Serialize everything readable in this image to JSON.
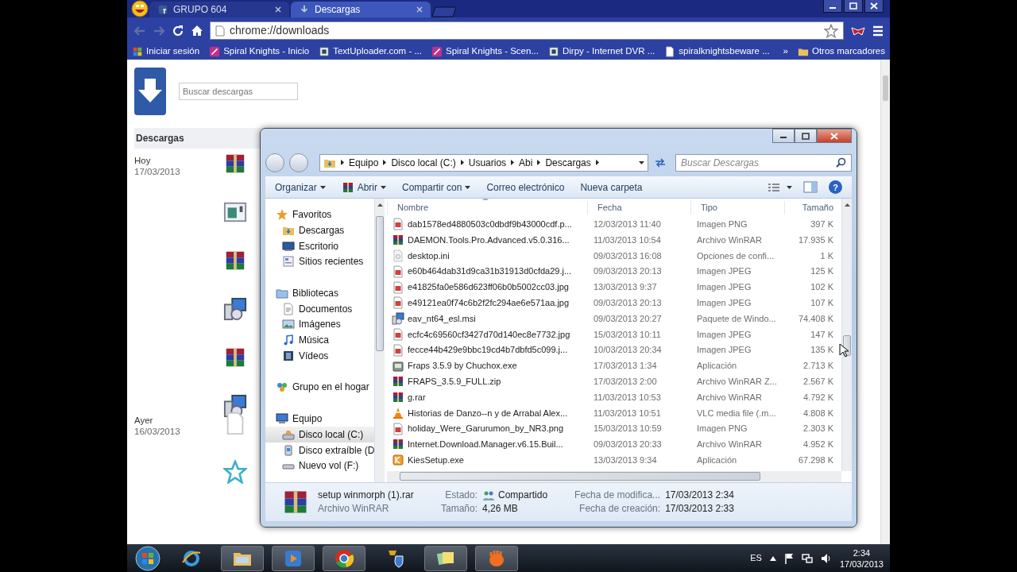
{
  "browser": {
    "tabs": [
      {
        "label": "GRUPO 604",
        "kind": "facebook",
        "selected": false
      },
      {
        "label": "Descargas",
        "kind": "download",
        "selected": true
      }
    ],
    "url": "chrome://downloads",
    "bookmarks": [
      {
        "label": "Iniciar sesión",
        "kind": "windows"
      },
      {
        "label": "Spiral Knights - Inicio",
        "kind": "sword"
      },
      {
        "label": "TextUploader.com - ...",
        "kind": "square"
      },
      {
        "label": "Spiral Knights - Scen...",
        "kind": "sword"
      },
      {
        "label": "Dirpy - Internet DVR ...",
        "kind": "square"
      },
      {
        "label": "spiralknightsbeware ...",
        "kind": "page"
      }
    ],
    "overflow": "»",
    "other_bookmarks": "Otros marcadores"
  },
  "downloads_page": {
    "search_placeholder": "Buscar descargas",
    "heading": "Descargas",
    "groups": [
      {
        "day": "Hoy",
        "date": "17/03/2013",
        "items": [
          {
            "kind": "rar"
          },
          {
            "kind": "window"
          },
          {
            "kind": "rar"
          },
          {
            "kind": "msi"
          },
          {
            "kind": "rar"
          },
          {
            "kind": "msi"
          }
        ]
      },
      {
        "day": "Ayer",
        "date": "16/03/2013",
        "items": [
          {
            "kind": "blank"
          },
          {
            "kind": "star"
          }
        ]
      }
    ]
  },
  "explorer": {
    "breadcrumb": [
      "Equipo",
      "Disco local (C:)",
      "Usuarios",
      "Abi",
      "Descargas"
    ],
    "search_placeholder": "Buscar Descargas",
    "commands": [
      {
        "label": "Organizar",
        "kind": "text",
        "dropdown": true
      },
      {
        "label": "Abrir",
        "kind": "archive",
        "dropdown": true
      },
      {
        "label": "Compartir con",
        "kind": "text",
        "dropdown": true
      },
      {
        "label": "Correo electrónico",
        "kind": "text",
        "dropdown": false
      },
      {
        "label": "Nueva carpeta",
        "kind": "text",
        "dropdown": false
      }
    ],
    "help": "?",
    "nav": [
      {
        "label": "Favoritos",
        "kind": "fav",
        "selected": false,
        "children": [
          {
            "label": "Descargas",
            "kind": "dlfolder",
            "selected": false
          },
          {
            "label": "Escritorio",
            "kind": "desktop",
            "selected": false
          },
          {
            "label": "Sitios recientes",
            "kind": "recent",
            "selected": false
          }
        ]
      },
      {
        "label": "Bibliotecas",
        "kind": "library",
        "selected": false,
        "children": [
          {
            "label": "Documentos",
            "kind": "doc",
            "selected": false
          },
          {
            "label": "Imágenes",
            "kind": "pictures",
            "selected": false
          },
          {
            "label": "Música",
            "kind": "music",
            "selected": false
          },
          {
            "label": "Vídeos",
            "kind": "video",
            "selected": false
          }
        ]
      },
      {
        "label": "Grupo en el hogar",
        "kind": "homegroup",
        "selected": false
      },
      {
        "label": "Equipo",
        "kind": "computer",
        "selected": false,
        "children": [
          {
            "label": "Disco local (C:)",
            "kind": "hdd",
            "selected": true
          },
          {
            "label": "Disco extraíble (D",
            "kind": "usb",
            "selected": false
          },
          {
            "label": "Nuevo vol (F:)",
            "kind": "vol",
            "selected": false
          }
        ]
      }
    ],
    "columns": [
      "Nombre",
      "Fecha",
      "Tipo",
      "Tamaño"
    ],
    "files": [
      {
        "kind": "image",
        "name": "dab1578ed4880503c0dbdf9b43000cdf.p...",
        "date": "12/03/2013 11:40",
        "type": "Imagen PNG",
        "size": "397 K"
      },
      {
        "kind": "rar",
        "name": "DAEMON.Tools.Pro.Advanced.v5.0.316...",
        "date": "11/03/2013 10:54",
        "type": "Archivo WinRAR",
        "size": "17.935 K"
      },
      {
        "kind": "ini",
        "name": "desktop.ini",
        "date": "09/03/2013 16:08",
        "type": "Opciones de confi...",
        "size": "1 K"
      },
      {
        "kind": "image",
        "name": "e60b464dab31d9ca31b31913d0cfda29.j...",
        "date": "09/03/2013 20:13",
        "type": "Imagen JPEG",
        "size": "125 K"
      },
      {
        "kind": "image",
        "name": "e41825fa0e586d623ff06b0b5002cc03.jpg",
        "date": "13/03/2013 9:37",
        "type": "Imagen JPEG",
        "size": "102 K"
      },
      {
        "kind": "image",
        "name": "e49121ea0f74c6b2f2fc294ae6e571aa.jpg",
        "date": "09/03/2013 20:13",
        "type": "Imagen JPEG",
        "size": "107 K"
      },
      {
        "kind": "msi",
        "name": "eav_nt64_esl.msi",
        "date": "09/03/2013 20:27",
        "type": "Paquete de Windo...",
        "size": "74.408 K"
      },
      {
        "kind": "image",
        "name": "ecfc4c69560cf3427d70d140ec8e7732.jpg",
        "date": "15/03/2013 10:11",
        "type": "Imagen JPEG",
        "size": "147 K"
      },
      {
        "kind": "image",
        "name": "fecce44b429e9bbc19cd4b7dbfd5c099.j...",
        "date": "10/03/2013 20:34",
        "type": "Imagen JPEG",
        "size": "135 K"
      },
      {
        "kind": "app",
        "name": "Fraps 3.5.9 by Chuchox.exe",
        "date": "17/03/2013 1:34",
        "type": "Aplicación",
        "size": "2.713 K"
      },
      {
        "kind": "rar",
        "name": "FRAPS_3.5.9_FULL.zip",
        "date": "17/03/2013 2:00",
        "type": "Archivo WinRAR Z...",
        "size": "2.567 K"
      },
      {
        "kind": "rar",
        "name": "g.rar",
        "date": "11/03/2013 10:53",
        "type": "Archivo WinRAR",
        "size": "4.792 K"
      },
      {
        "kind": "vlc",
        "name": "Historias de Danzo--n y de Arrabal Alex...",
        "date": "11/03/2013 10:51",
        "type": "VLC media file (.m...",
        "size": "4.808 K"
      },
      {
        "kind": "image",
        "name": "holiday_Were_Garurumon_by_NR3.png",
        "date": "15/03/2013 10:59",
        "type": "Imagen PNG",
        "size": "2.303 K"
      },
      {
        "kind": "rar",
        "name": "Internet.Download.Manager.v6.15.Buil...",
        "date": "09/03/2013 20:33",
        "type": "Archivo WinRAR",
        "size": "4.952 K"
      },
      {
        "kind": "kies",
        "name": "KiesSetup.exe",
        "date": "13/03/2013 9:34",
        "type": "Aplicación",
        "size": "67.298 K"
      }
    ],
    "details": {
      "kind": "rar",
      "name": "setup winmorph (1).rar",
      "type": "Archivo WinRAR",
      "fields": [
        {
          "label": "Estado:",
          "value": "Compartido",
          "kind": "shared"
        },
        {
          "label": "Fecha de modifica...",
          "value": "17/03/2013 2:34"
        },
        {
          "label": "Tamaño:",
          "value": "4,26 MB"
        },
        {
          "label": "Fecha de creación:",
          "value": "17/03/2013 2:33"
        }
      ]
    }
  },
  "taskbar": {
    "apps": [
      {
        "kind": "ie",
        "open": false
      },
      {
        "kind": "explorer",
        "open": true
      },
      {
        "kind": "media",
        "open": true
      },
      {
        "kind": "chrome",
        "open": true
      },
      {
        "kind": "shield",
        "open": false
      },
      {
        "kind": "sticky",
        "open": true
      },
      {
        "kind": "glove",
        "open": true
      }
    ],
    "language": "ES",
    "time": "2:34",
    "date": "17/03/2013"
  }
}
